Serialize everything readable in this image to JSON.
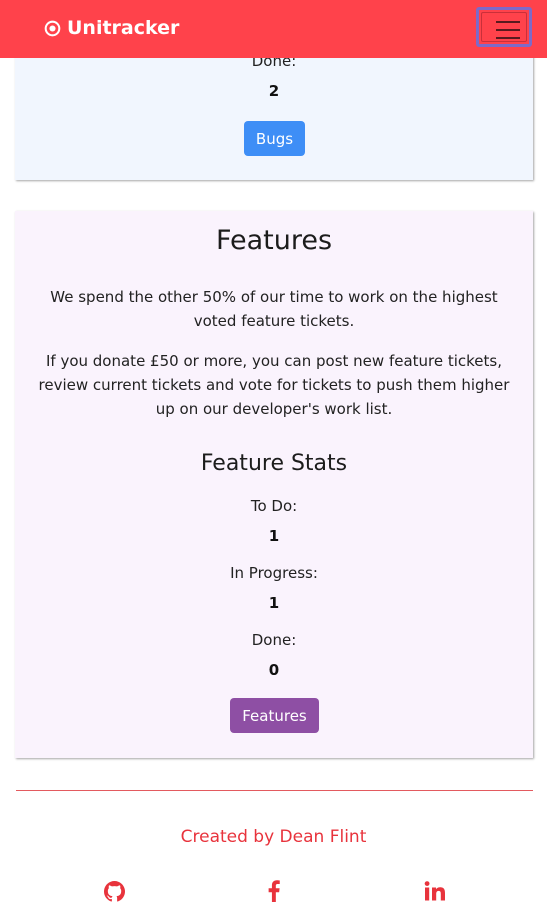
{
  "navbar": {
    "brand": "Unitracker",
    "brand_icon": "dot-circle-icon",
    "menu_icon": "hamburger-menu-icon",
    "background": "#ff424b"
  },
  "bugs_card": {
    "done_label": "Done:",
    "done_value": "2",
    "button_label": "Bugs",
    "button_color": "#3e8ef6"
  },
  "features_card": {
    "title": "Features",
    "paragraph1_line1": "We spend the other 50% of our time to work on the highest",
    "paragraph1_line2": "voted feature tickets.",
    "paragraph2_line1": "If you donate £50 or more, you can post new feature tickets,",
    "paragraph2_line2": "review current tickets and vote for tickets to push them higher",
    "paragraph2_line3": "up on our developer's work list.",
    "stats_title": "Feature Stats",
    "todo_label": "To Do:",
    "todo_value": "1",
    "progress_label": "In Progress:",
    "progress_value": "1",
    "done_label": "Done:",
    "done_value": "0",
    "button_label": "Features",
    "button_color": "#8e4fa4"
  },
  "footer": {
    "credit": "Created by Dean Flint",
    "links": [
      "github-icon",
      "facebook-icon",
      "linkedin-icon"
    ]
  }
}
